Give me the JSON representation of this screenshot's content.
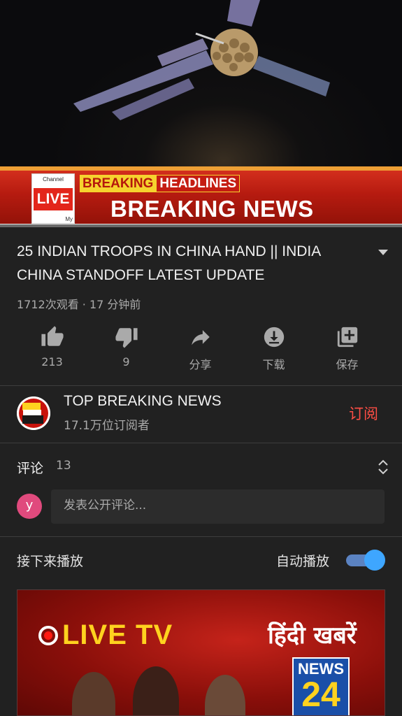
{
  "player": {
    "ticker": {
      "channel_label": "Channel",
      "live_label": "LIVE",
      "my_label": "My",
      "breaking_label": "BREAKING",
      "headlines_label": "HEADLINES",
      "main_text": "BREAKING NEWS"
    },
    "progress": 0.0
  },
  "video": {
    "title": "25 INDIAN TROOPS IN CHINA HAND || INDIA CHINA STANDOFF LATEST UPDATE",
    "meta": "1712次观看 · 17 分钟前"
  },
  "actions": [
    {
      "icon": "thumbs-up-icon",
      "label": "213"
    },
    {
      "icon": "thumbs-down-icon",
      "label": "9"
    },
    {
      "icon": "share-icon",
      "label": "分享"
    },
    {
      "icon": "download-icon",
      "label": "下载"
    },
    {
      "icon": "save-to-playlist-icon",
      "label": "保存"
    }
  ],
  "channel": {
    "name": "TOP BREAKING NEWS",
    "subscribers": "17.1万位订阅者",
    "subscribe_label": "订阅",
    "avatar_text": [
      "TOP",
      "BREAKING",
      "NEWS"
    ]
  },
  "comments": {
    "label": "评论",
    "count": "13",
    "user_initial": "y",
    "placeholder": "发表公开评论..."
  },
  "up_next": {
    "label": "接下来播放",
    "autoplay_label": "自动播放",
    "autoplay_on": true
  },
  "next_video": {
    "live_tv": "LIVE TV",
    "hindi_text": "हिंदी खबरें",
    "logo_top": "NEWS",
    "logo_num": "24"
  },
  "colors": {
    "background": "#212121",
    "subscribe": "#ff4e45",
    "toggle": "#3ea6ff"
  }
}
